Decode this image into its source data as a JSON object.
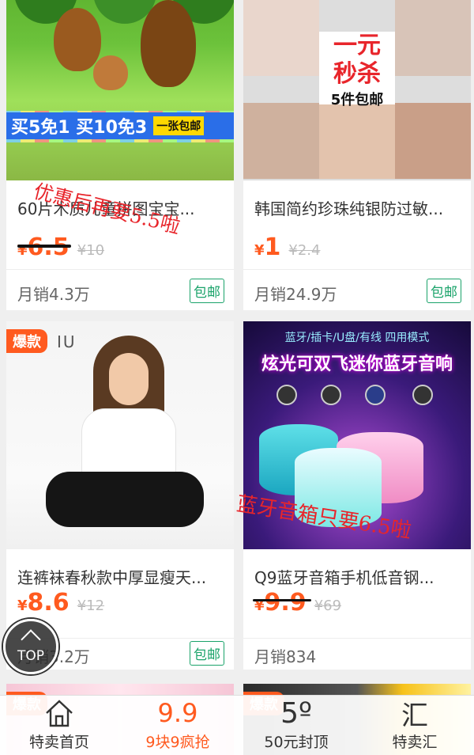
{
  "products": [
    {
      "title": "60片木质儿童拼图宝宝...",
      "price": "6.5",
      "original_price": "¥10",
      "sales": "月销4.3万",
      "badge": "包邮",
      "image_text": {
        "banner": "买5免1 买10免3",
        "tag": "一张包邮"
      }
    },
    {
      "title": "韩国简约珍珠纯银防过敏...",
      "price": "1",
      "original_price": "¥2.4",
      "sales": "月销24.9万",
      "badge": "包邮",
      "image_text": {
        "line1": "一元",
        "line2": "秒杀",
        "line3": "5件包邮"
      }
    },
    {
      "hot_label": "爆款",
      "title": "连裤袜春秋款中厚显瘦天...",
      "price": "8.6",
      "original_price": "¥12",
      "sales": "月销3.2万",
      "badge": "包邮",
      "image_text": {
        "logo": "IU"
      }
    },
    {
      "title": "Q9蓝牙音箱手机低音钢...",
      "price": "9.9",
      "original_price": "¥69",
      "sales": "月销834",
      "image_text": {
        "strip": "蓝牙/插卡/U盘/有线 四用模式",
        "headline": "炫光可双飞迷你蓝牙音响"
      }
    }
  ],
  "next_row": [
    {
      "hot_label": "爆款"
    },
    {
      "hot_label": "爆款"
    }
  ],
  "currency": "¥",
  "overlays": {
    "promo_1": "优惠后再要5.5啦",
    "promo_2": "蓝牙音箱只要6.5啦"
  },
  "top_button": "TOP",
  "tabbar": {
    "items": [
      {
        "icon": "home-icon",
        "label": "特卖首页"
      },
      {
        "icon": "9.9-icon",
        "icon_text": "9.9",
        "label": "9块9疯抢"
      },
      {
        "icon": "50-icon",
        "icon_text": "5º",
        "label": "50元封顶"
      },
      {
        "icon": "hui-icon",
        "icon_text": "汇",
        "label": "特卖汇"
      }
    ],
    "active_index": 1
  },
  "colors": {
    "accent": "#ff5a1f",
    "free_shipping": "#1aa36a",
    "overlay_red": "#e8252b"
  }
}
